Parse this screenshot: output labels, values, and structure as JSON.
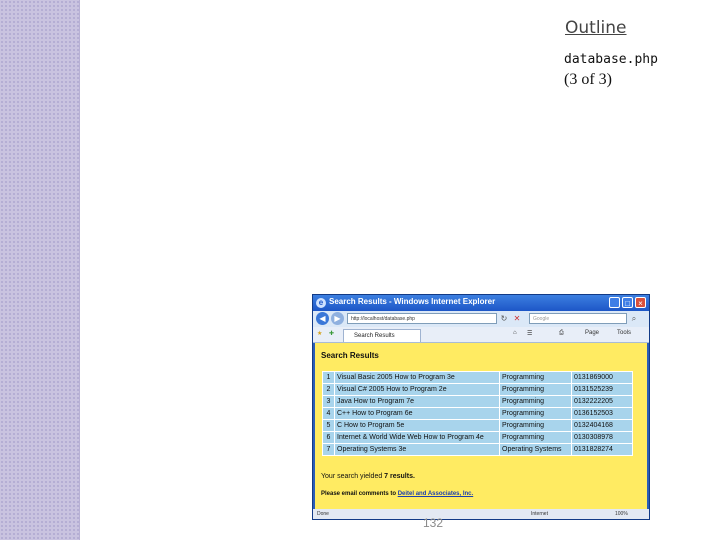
{
  "slide": {
    "outline_label": "Outline",
    "file_name": "database.php",
    "page_of": "(3 of 3)",
    "slide_number": "132"
  },
  "browser": {
    "title": "Search Results - Windows Internet Explorer",
    "address": "http://localhost/database.php",
    "search_placeholder": "Google",
    "tab_label": "Search Results",
    "page_menu": "Page",
    "tools_menu": "Tools",
    "status_done": "Done",
    "status_zone": "Internet",
    "zoom": "100%"
  },
  "page": {
    "heading": "Search Results",
    "rows": [
      [
        "1",
        "Visual Basic 2005 How to Program 3e",
        "Programming",
        "0131869000"
      ],
      [
        "2",
        "Visual C# 2005 How to Program 2e",
        "Programming",
        "0131525239"
      ],
      [
        "3",
        "Java How to Program 7e",
        "Programming",
        "0132222205"
      ],
      [
        "4",
        "C++ How to Program 6e",
        "Programming",
        "0136152503"
      ],
      [
        "5",
        "C How to Program 5e",
        "Programming",
        "0132404168"
      ],
      [
        "6",
        "Internet & World Wide Web How to Program 4e",
        "Programming",
        "0130308978"
      ],
      [
        "7",
        "Operating Systems 3e",
        "Operating Systems",
        "0131828274"
      ]
    ],
    "yield_prefix": "Your search yielded ",
    "yield_count": "7 results.",
    "email_prefix": "Please email comments to ",
    "email_link": "Deitel and Associates, Inc."
  },
  "colors": {
    "page_bg": "#ffeb62",
    "cell_bg": "#a8d4ec",
    "titlebar": "#1d56c7",
    "sidebar": "#c9c3e0"
  }
}
